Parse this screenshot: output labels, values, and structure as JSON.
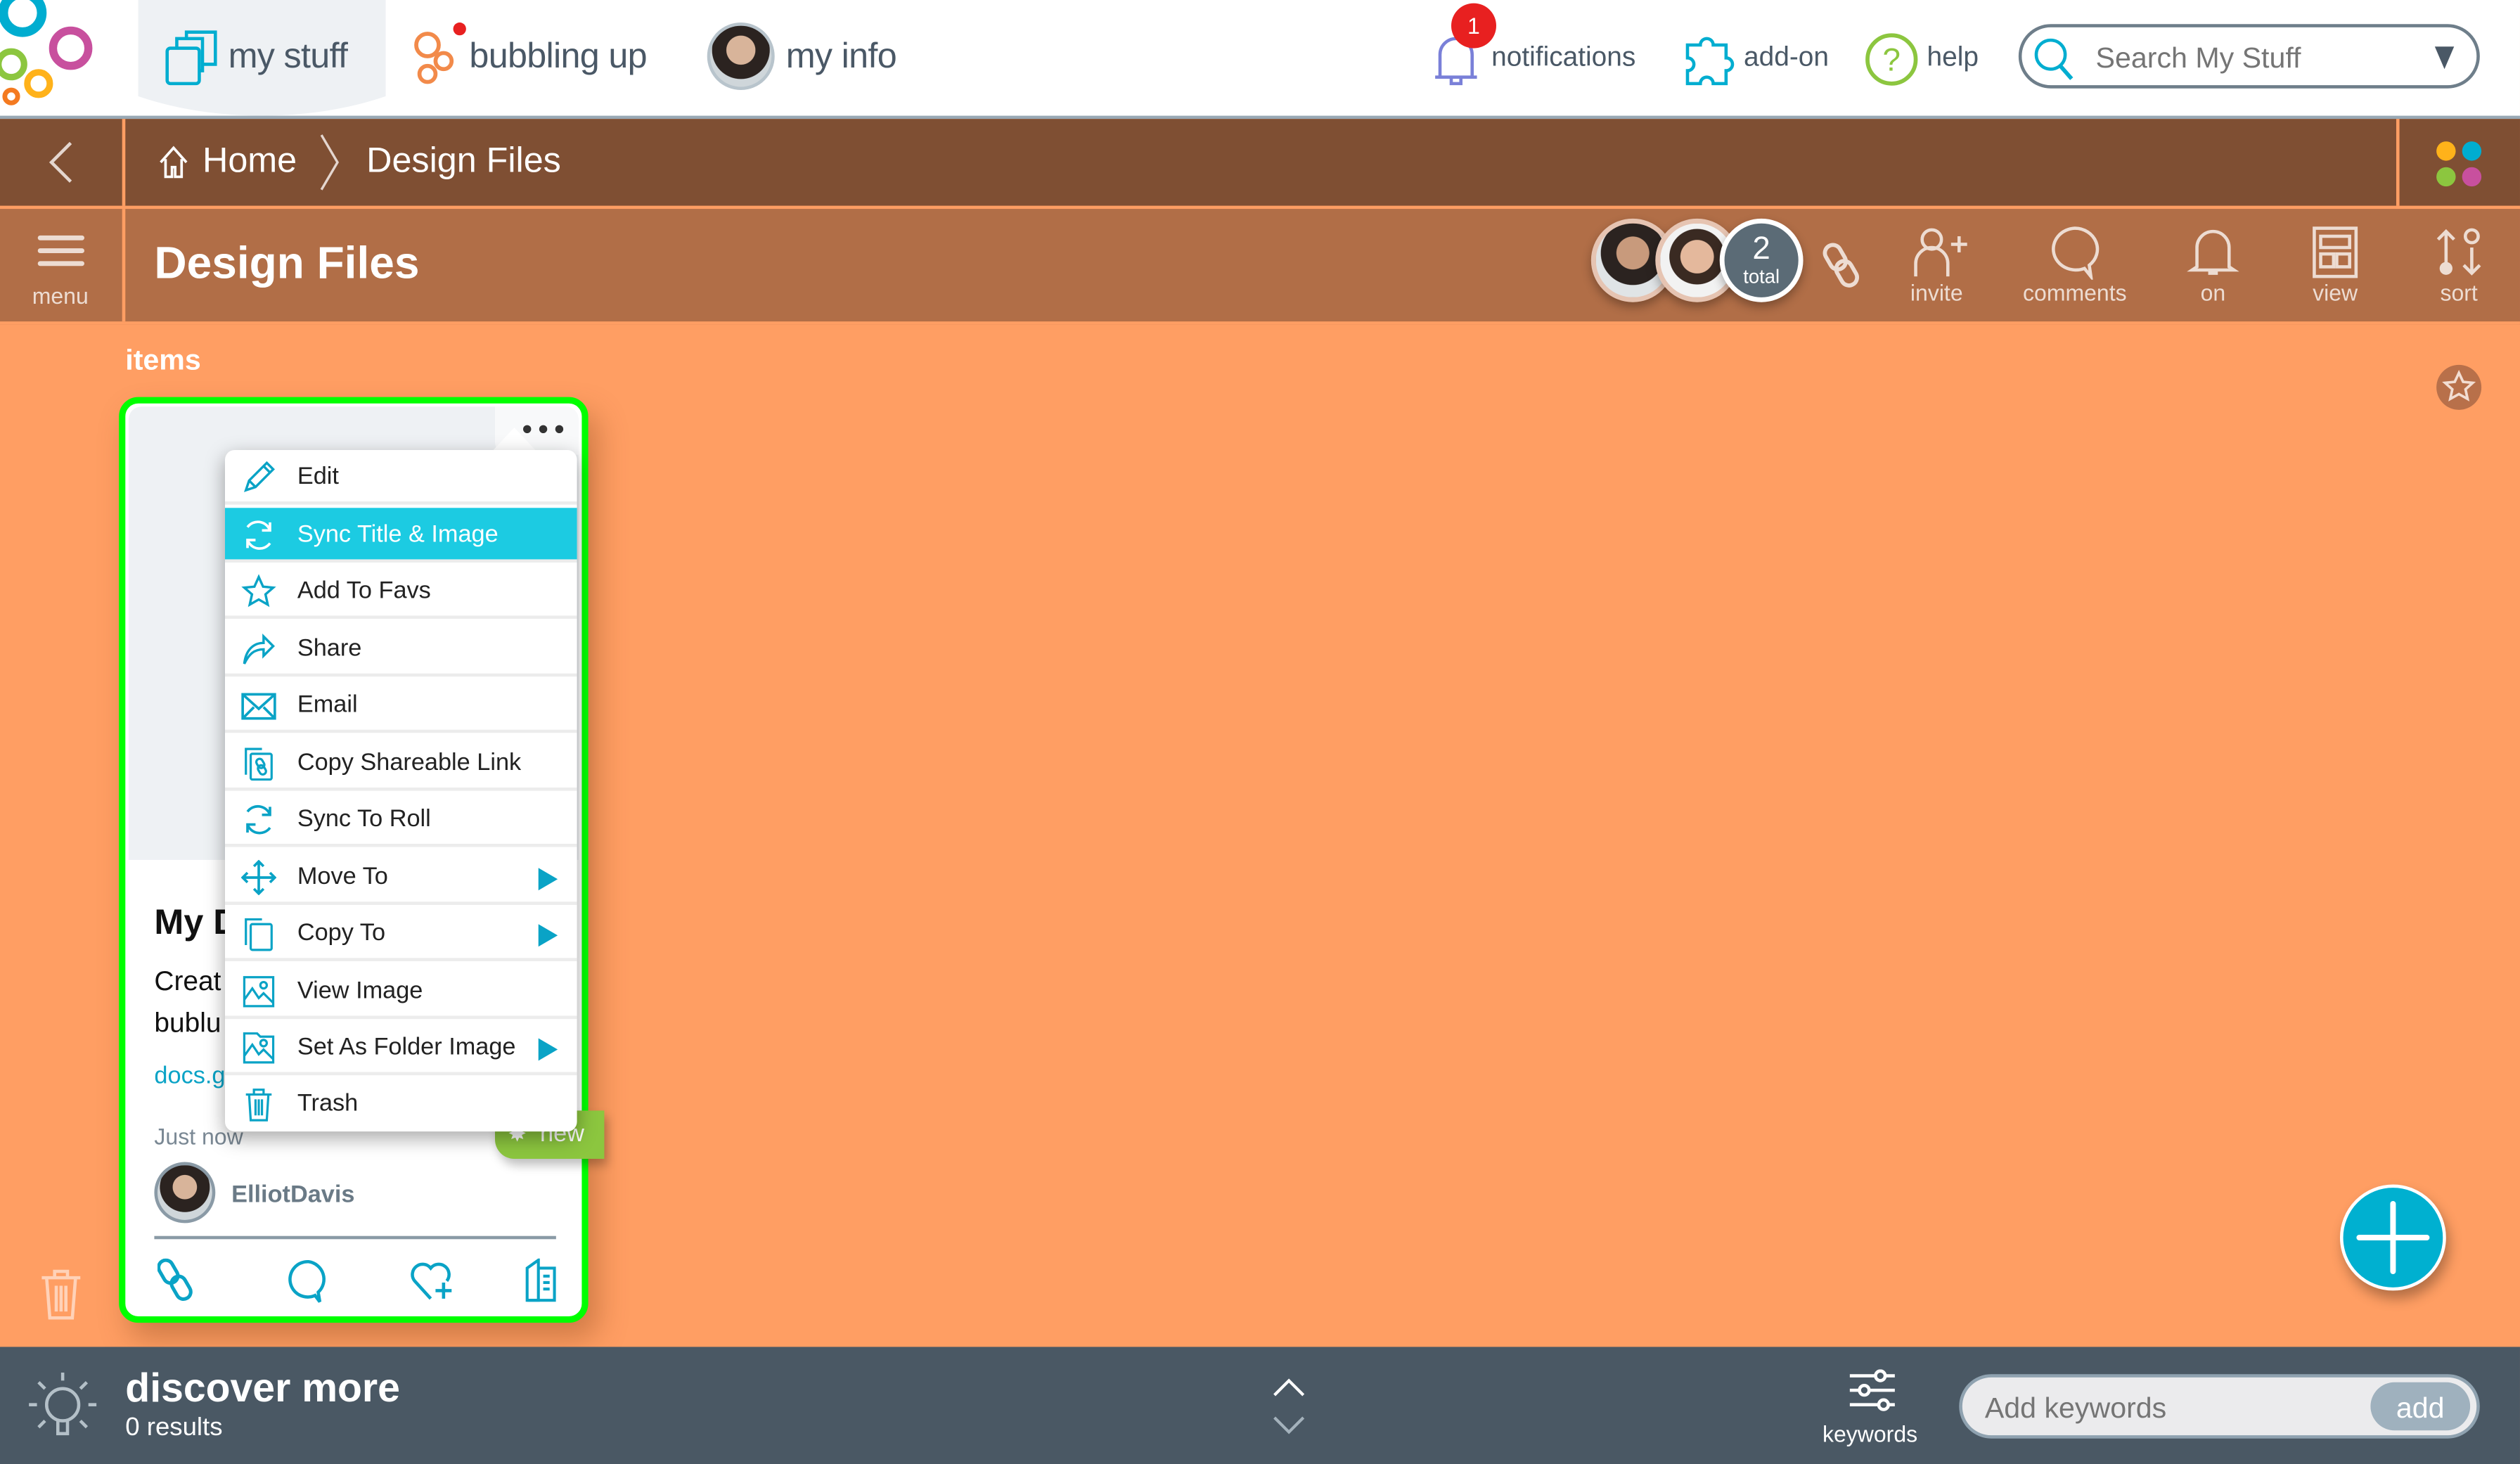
{
  "topnav": {
    "tabs": [
      {
        "label": "my stuff",
        "icon": "folders-icon",
        "active": true
      },
      {
        "label": "bubbling up",
        "icon": "bubbles-icon",
        "has_dot": true
      },
      {
        "label": "my info",
        "icon": "avatar"
      }
    ],
    "notifications": {
      "label": "notifications",
      "badge": "1"
    },
    "addon": {
      "label": "add-on"
    },
    "help": {
      "label": "help"
    },
    "search": {
      "placeholder": "Search My Stuff",
      "value": ""
    }
  },
  "breadcrumb": {
    "back_icon": "chevron-left-icon",
    "items": [
      {
        "label": "Home",
        "icon": "home-icon"
      },
      {
        "label": "Design Files"
      }
    ]
  },
  "titlebar": {
    "menu_label": "menu",
    "title": "Design Files",
    "members_total": "2",
    "members_total_label": "total",
    "tools": [
      {
        "label": "invite",
        "icon": "invite-user-icon"
      },
      {
        "label": "comments",
        "icon": "comment-icon"
      },
      {
        "label": "on",
        "icon": "bell-icon"
      },
      {
        "label": "view",
        "icon": "layout-icon"
      },
      {
        "label": "sort",
        "icon": "sort-icon"
      }
    ]
  },
  "content": {
    "section_label": "items",
    "card": {
      "title": "My D",
      "desc_line1": "Creat",
      "desc_line2": "bublu",
      "link": "docs.g",
      "time": "Just now",
      "badge": "new",
      "author": "ElliotDavis"
    },
    "context_menu": [
      {
        "label": "Edit",
        "icon": "pencil-icon"
      },
      {
        "label": "Sync Title & Image",
        "icon": "sync-icon",
        "highlighted": true
      },
      {
        "label": "Add To Favs",
        "icon": "star-icon"
      },
      {
        "label": "Share",
        "icon": "share-icon"
      },
      {
        "label": "Email",
        "icon": "email-icon"
      },
      {
        "label": "Copy Shareable Link",
        "icon": "copy-link-icon"
      },
      {
        "label": "Sync To Roll",
        "icon": "sync-icon"
      },
      {
        "label": "Move To",
        "icon": "move-icon",
        "submenu": true
      },
      {
        "label": "Copy To",
        "icon": "copy-icon",
        "submenu": true
      },
      {
        "label": "View Image",
        "icon": "image-icon"
      },
      {
        "label": "Set As Folder Image",
        "icon": "folder-image-icon",
        "submenu": true
      },
      {
        "label": "Trash",
        "icon": "trash-icon"
      }
    ]
  },
  "bottombar": {
    "title": "discover more",
    "results": "0 results",
    "keywords_label": "keywords",
    "keywords_placeholder": "Add keywords",
    "add_label": "add"
  },
  "colors": {
    "accent": "#00b0d0",
    "background": "#ff9e63",
    "breadcrumb_bar": "#7f4f33",
    "title_bar": "#b16e47",
    "card_border": "#00ff00",
    "bottom_bar": "#4a5864",
    "menu_highlight": "#1ccbe2",
    "new_badge": "#8cc63f"
  }
}
